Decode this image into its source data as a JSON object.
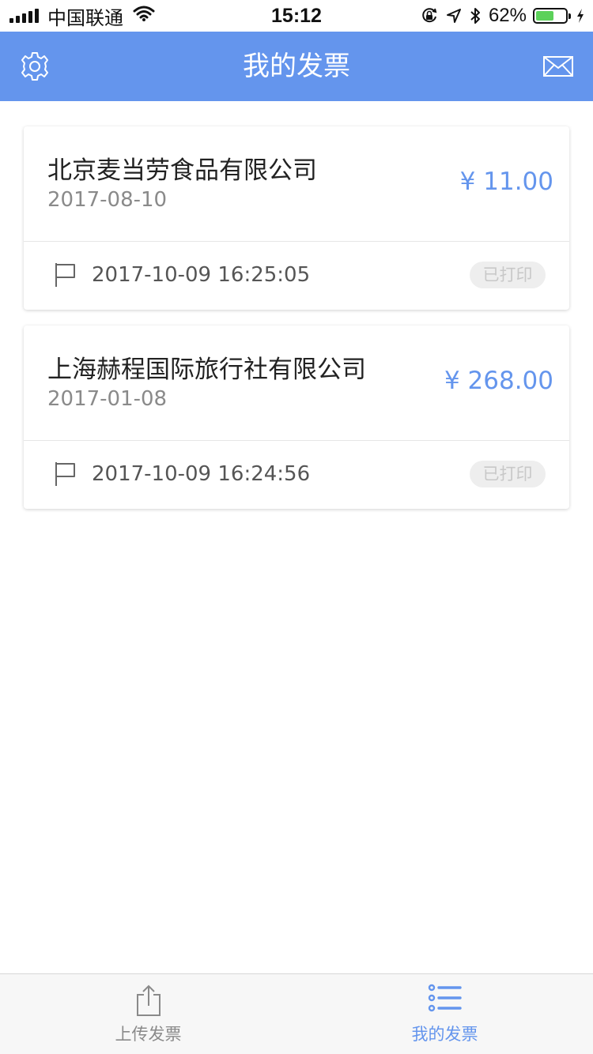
{
  "status_bar": {
    "carrier": "中国联通",
    "time": "15:12",
    "battery_percent": "62%",
    "battery_level": 0.62
  },
  "nav": {
    "title": "我的发票",
    "left_icon": "gear-icon",
    "right_icon": "mail-icon"
  },
  "invoices": [
    {
      "company": "北京麦当劳食品有限公司",
      "date": "2017-08-10",
      "amount": "¥ 11.00",
      "upload_time": "2017-10-09 16:25:05",
      "status": "已打印"
    },
    {
      "company": "上海赫程国际旅行社有限公司",
      "date": "2017-01-08",
      "amount": "¥ 268.00",
      "upload_time": "2017-10-09 16:24:56",
      "status": "已打印"
    }
  ],
  "tabs": [
    {
      "label": "上传发票",
      "icon": "upload-icon",
      "active": false
    },
    {
      "label": "我的发票",
      "icon": "list-icon",
      "active": true
    }
  ],
  "colors": {
    "accent": "#6495ed",
    "badge_bg": "#eeeeee",
    "badge_text": "#c8c8c8",
    "battery": "#5cd15a"
  }
}
